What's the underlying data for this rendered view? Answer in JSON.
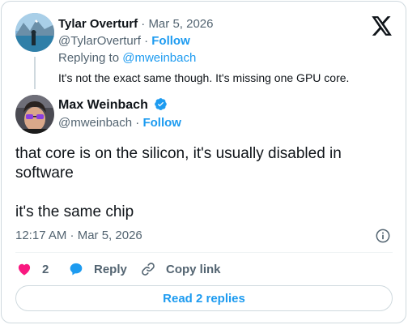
{
  "parent": {
    "name": "Tylar Overturf",
    "dot": "·",
    "date": "Mar 5, 2026",
    "handle": "@TylarOverturf",
    "follow": "Follow",
    "replying_prefix": "Replying to ",
    "replying_handle": "@mweinbach",
    "text": "It's not the exact same though. It's missing one GPU core."
  },
  "tweet": {
    "name": "Max Weinbach",
    "handle": "@mweinbach",
    "follow": "Follow",
    "body_line1": "that core is on the silicon, it's usually disabled in software",
    "body_line2": "it's the same chip",
    "timestamp": "12:17 AM · Mar 5, 2026"
  },
  "actions": {
    "like_count": "2",
    "reply_label": "Reply",
    "copy_label": "Copy link",
    "read_replies": "Read 2 replies"
  },
  "colors": {
    "accent": "#1d9bf0",
    "like": "#f91880",
    "muted": "#536471",
    "text": "#0f1419",
    "border": "#cfd9de"
  },
  "icons": {
    "brand": "x-logo-icon",
    "verified": "verified-badge-icon",
    "info": "info-icon",
    "like": "heart-icon",
    "reply": "speech-bubble-icon",
    "copy": "link-icon"
  }
}
